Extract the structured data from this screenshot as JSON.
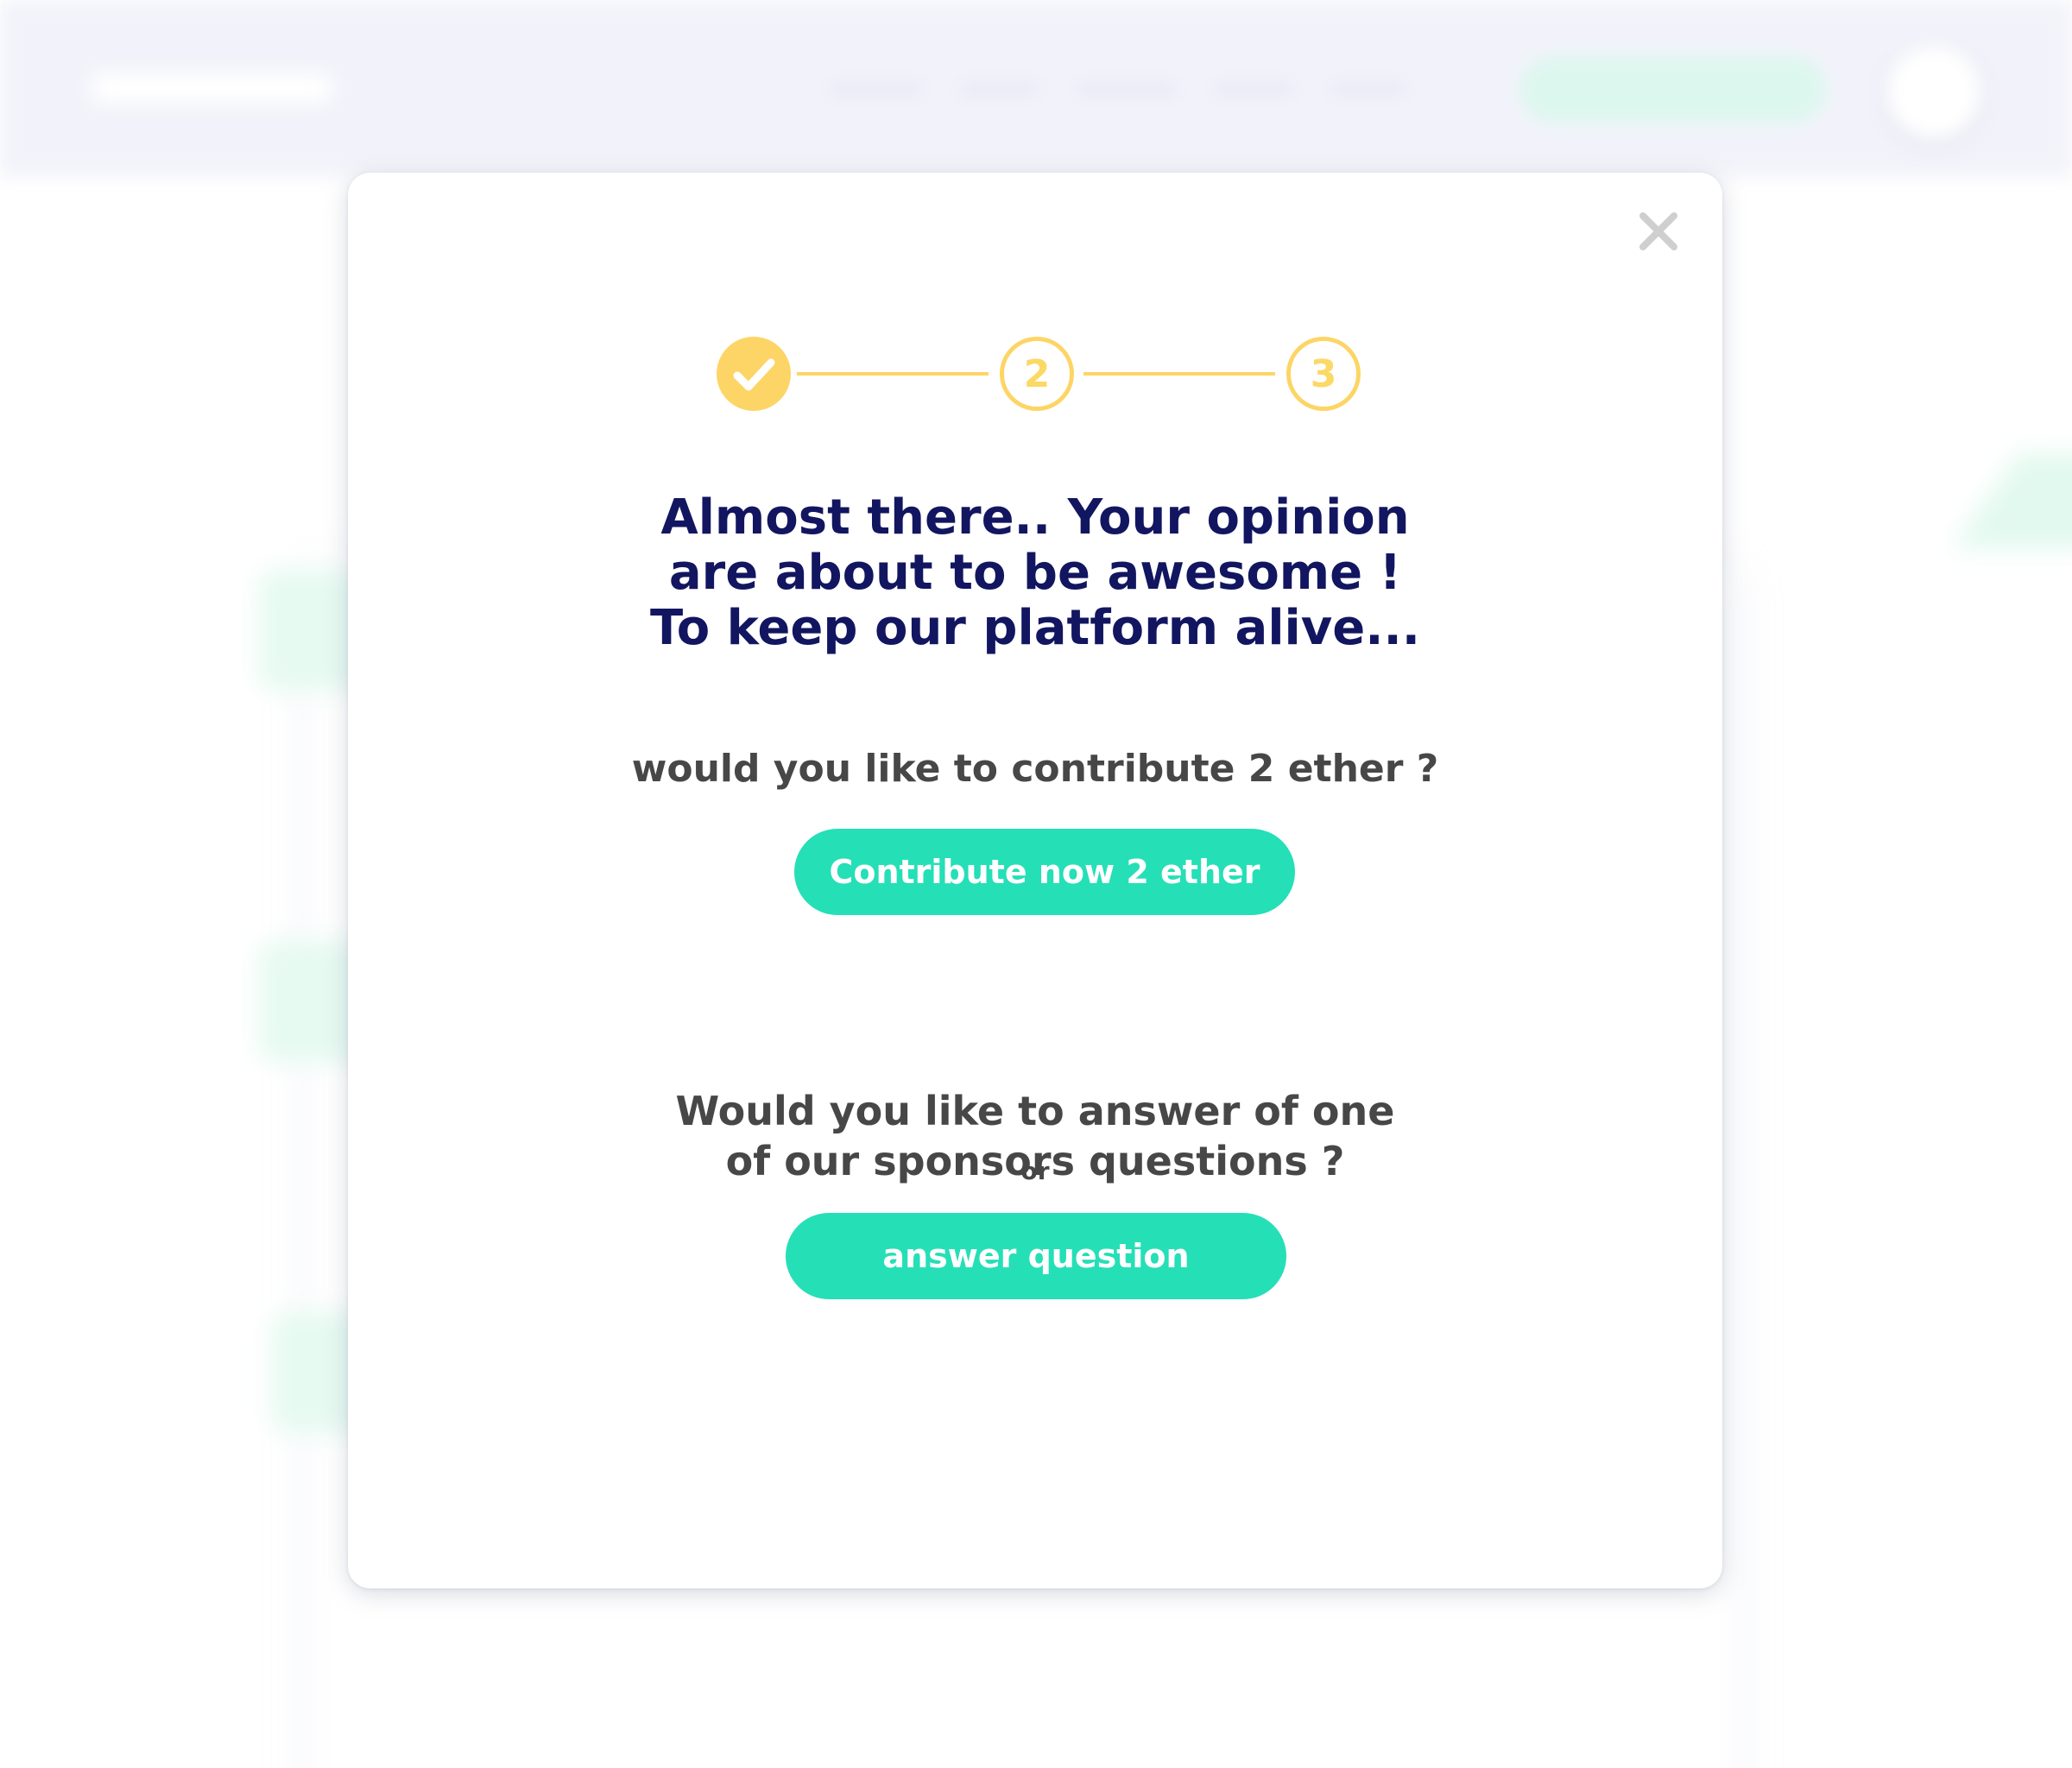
{
  "modal": {
    "close_label": "×",
    "stepper": {
      "steps": [
        {
          "label": "",
          "state": "done"
        },
        {
          "label": "2",
          "state": "todo"
        },
        {
          "label": "3",
          "state": "todo"
        }
      ],
      "accent_color": "#fdd566"
    },
    "headline": [
      "Almost there.. Your opinion",
      "are about to be awesome !",
      "To keep our platform alive..."
    ],
    "contribute_question": "would you like to contribute 2 ether ?",
    "contribute_button": "Contribute now 2 ether",
    "or_label": "or",
    "sponsor_question": [
      "Would you like to answer of one",
      "of our sponsors questions ?"
    ],
    "answer_button": "answer question"
  },
  "colors": {
    "headline": "#121660",
    "body_text": "#474747",
    "button": "#25dfb7",
    "step": "#fdd566"
  },
  "icons": {
    "close": "close-icon",
    "step_done": "checkmark-icon"
  }
}
